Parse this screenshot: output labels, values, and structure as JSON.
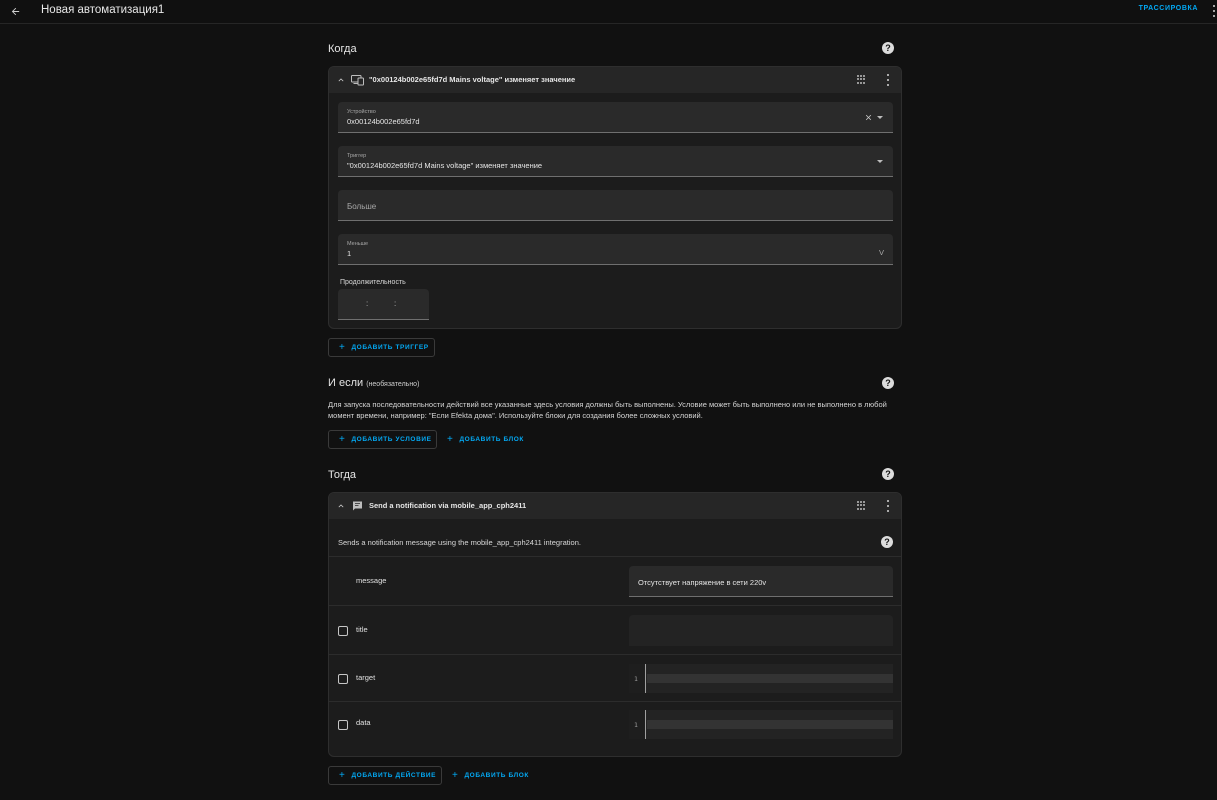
{
  "header": {
    "title": "Новая автоматизация1",
    "trace_label": "ТРАССИРОВКА"
  },
  "when": {
    "title": "Когда",
    "trigger_card": {
      "header": "\"0x00124b002e65fd7d Mains voltage\" изменяет значение",
      "device_label": "Устройство",
      "device_value": "0x00124b002e65fd7d",
      "trigger_label": "Триггер",
      "trigger_value": "\"0x00124b002e65fd7d Mains voltage\" изменяет значение",
      "above_placeholder": "Больше",
      "below_label": "Меньше",
      "below_value": "1",
      "below_unit": "V",
      "duration_label": "Продолжительность",
      "duration_sep": ":"
    },
    "add_trigger_label": "ДОБАВИТЬ ТРИГГЕР"
  },
  "and_if": {
    "title": "И если",
    "optional_label": "(необязательно)",
    "description": "Для запуска последовательности действий все указанные здесь условия должны быть выполнены. Условие может быть выполнено или не выполнено в любой момент времени, например: \"Если Efekta дома\". Используйте блоки для создания более сложных условий.",
    "add_condition_label": "ДОБАВИТЬ УСЛОВИЕ",
    "add_block_label": "ДОБАВИТЬ БЛОК"
  },
  "then": {
    "title": "Тогда",
    "action_card": {
      "header": "Send a notification via mobile_app_cph2411",
      "description": "Sends a notification message using the mobile_app_cph2411 integration.",
      "fields": [
        {
          "name": "message",
          "value": "Отсутствует напряжение в сети 220v"
        },
        {
          "name": "title",
          "value": ""
        },
        {
          "name": "target",
          "line_number": "1"
        },
        {
          "name": "data",
          "line_number": "1"
        }
      ]
    },
    "add_action_label": "ДОБАВИТЬ ДЕЙСТВИЕ",
    "add_block_label": "ДОБАВИТЬ БЛОК"
  },
  "colors": {
    "accent": "#03a9f4",
    "background": "#111111",
    "card": "#1c1c1c"
  }
}
